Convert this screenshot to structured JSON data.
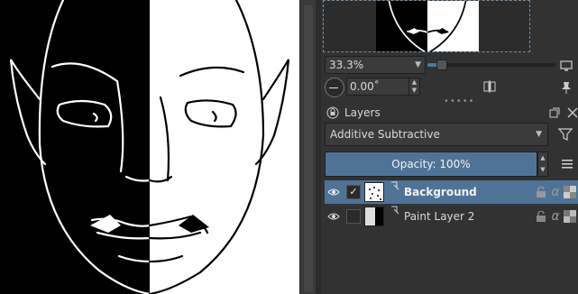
{
  "navigator": {
    "zoom_value": "33.3%",
    "zoom_slider_fraction": 0.08,
    "rotation_value": "0.00˚",
    "dots": "•••••"
  },
  "layers_panel": {
    "title": "Layers",
    "blend_mode": "Additive Subtractive",
    "opacity_label": "Opacity:  100%",
    "layers": [
      {
        "name": "Background",
        "selected": true,
        "visible": true,
        "checked": true
      },
      {
        "name": "Paint Layer 2",
        "selected": false,
        "visible": true,
        "checked": false
      }
    ]
  },
  "colors": {
    "accent": "#4f7397",
    "panel": "#323232",
    "canvas_dark": "#000000",
    "canvas_light": "#ffffff"
  },
  "icons": [
    "monitor-icon",
    "pin-icon",
    "rotate-dial-icon",
    "mirror-icon",
    "lock-icon",
    "float-window-icon",
    "close-icon",
    "filter-icon",
    "hamburger-menu-icon",
    "eye-icon",
    "inherit-alpha-icon",
    "alpha-lock-icon",
    "transparency-icon"
  ]
}
